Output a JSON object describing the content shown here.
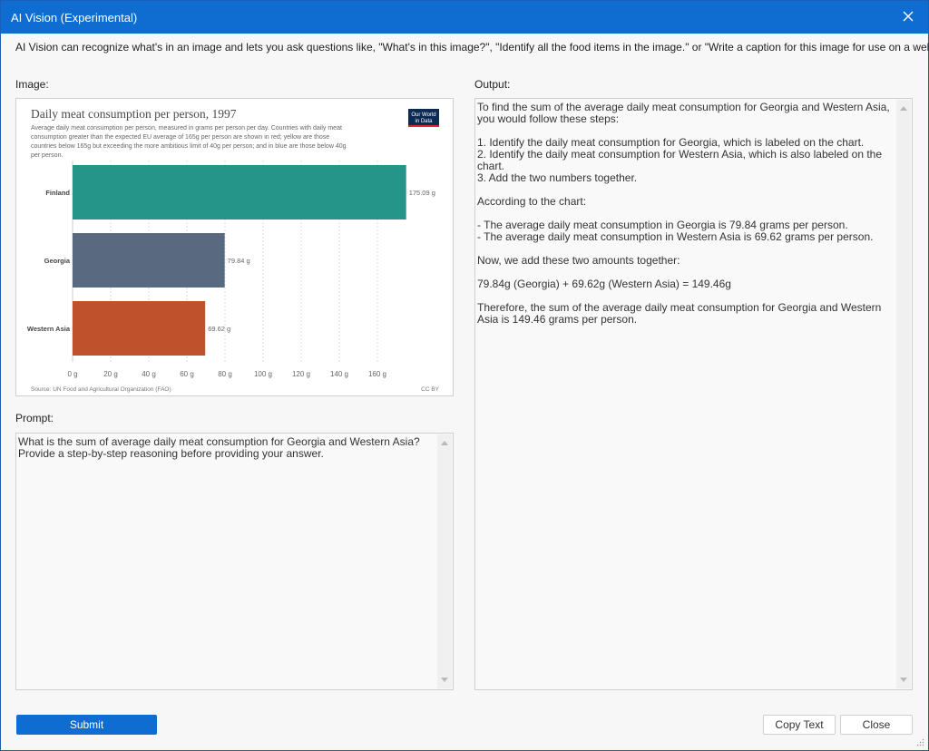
{
  "window": {
    "title": "AI Vision (Experimental)",
    "description": "AI Vision can recognize what's in an image and lets you ask questions like, \"What's in this image?\", \"Identify all the food items in the image.\" or \"Write a caption for this image for use on a website\""
  },
  "labels": {
    "image": "Image:",
    "prompt": "Prompt:",
    "output": "Output:"
  },
  "chart": {
    "title": "Daily meat consumption per person, 1997",
    "subtitle_lines": [
      "Average daily meat consumption per person, measured in grams per person per day. Countries with daily meat",
      "consumption greater than the expected EU average of 165g per person are shown in red; yellow are those",
      "countries below 165g but exceeding the more ambitious limit of 40g per person; and in blue are those below 40g",
      "per person."
    ],
    "logo_line1": "Our World",
    "logo_line2": "in Data",
    "source": "Source: UN Food and Agricultural Organization (FAO)",
    "license": "CC BY"
  },
  "chart_data": {
    "type": "bar",
    "orientation": "horizontal",
    "title": "Daily meat consumption per person, 1997",
    "categories": [
      "Finland",
      "Georgia",
      "Western Asia"
    ],
    "values": [
      175.09,
      79.84,
      69.62
    ],
    "value_labels": [
      "175.09 g",
      "79.84 g",
      "69.62 g"
    ],
    "colors": [
      "#259589",
      "#596a80",
      "#bf512c"
    ],
    "xlim": [
      0,
      175
    ],
    "x_ticks": [
      0,
      20,
      40,
      60,
      80,
      100,
      120,
      140,
      160
    ],
    "x_tick_labels": [
      "0 g",
      "20 g",
      "40 g",
      "60 g",
      "80 g",
      "100 g",
      "120 g",
      "140 g",
      "160 g"
    ],
    "grid": true
  },
  "prompt": {
    "text": "What is the sum of average daily meat consumption for Georgia and Western Asia? Provide a step-by-step reasoning before providing your answer."
  },
  "output": {
    "text": "To find the sum of the average daily meat consumption for Georgia and Western Asia, you would follow these steps:\n\n1. Identify the daily meat consumption for Georgia, which is labeled on the chart.\n2. Identify the daily meat consumption for Western Asia, which is also labeled on the chart.\n3. Add the two numbers together.\n\nAccording to the chart:\n\n- The average daily meat consumption in Georgia is 79.84 grams per person.\n- The average daily meat consumption in Western Asia is 69.62 grams per person.\n\nNow, we add these two amounts together:\n\n79.84g (Georgia) + 69.62g (Western Asia) = 149.46g\n\nTherefore, the sum of the average daily meat consumption for Georgia and Western Asia is 149.46 grams per person."
  },
  "buttons": {
    "submit": "Submit",
    "copy": "Copy Text",
    "close": "Close"
  },
  "colors": {
    "accent": "#0f6cd1",
    "logo_bg": "#0c2b52",
    "logo_stripe": "#d42b2b"
  }
}
